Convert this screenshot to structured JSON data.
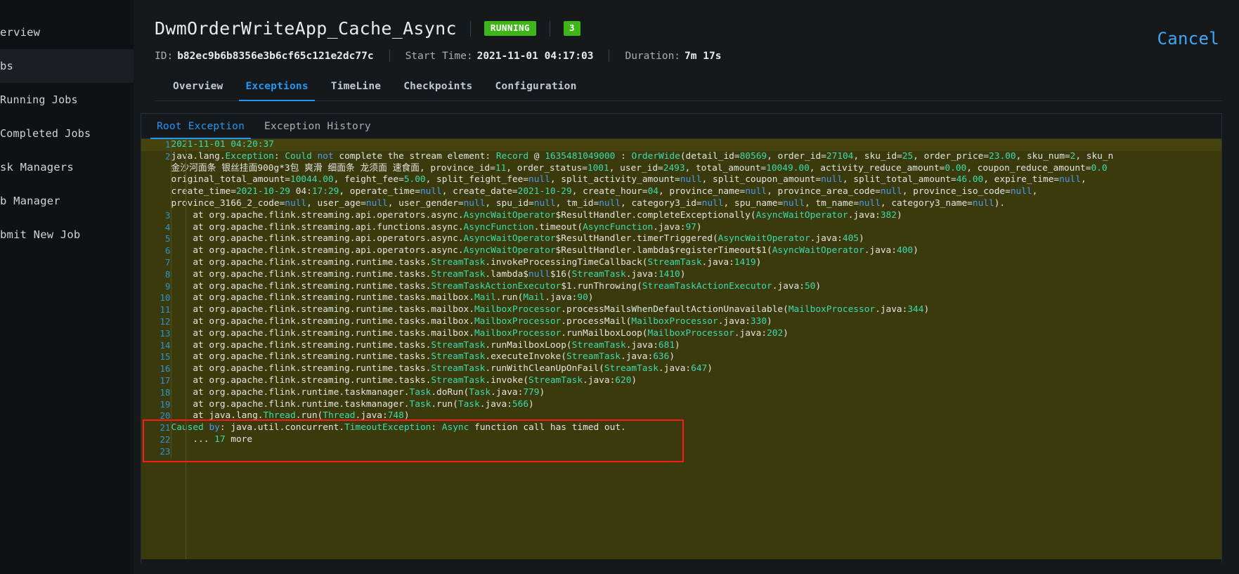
{
  "sidebar": {
    "items": [
      {
        "label": "erview"
      },
      {
        "label": "bs"
      },
      {
        "label": "Running Jobs"
      },
      {
        "label": "Completed Jobs"
      },
      {
        "label": "sk Managers"
      },
      {
        "label": "b Manager"
      },
      {
        "label": "bmit New Job"
      }
    ]
  },
  "header": {
    "job_name": "DwmOrderWriteApp_Cache_Async",
    "status_badge": "RUNNING",
    "parallelism_badge": "3",
    "id_label": "ID:",
    "id_value": "b82ec9b6b8356e3b6cf65c121e2dc77c",
    "start_time_label": "Start Time:",
    "start_time_value": "2021-11-01 04:17:03",
    "duration_label": "Duration:",
    "duration_value": "7m 17s",
    "cancel_label": "Cancel",
    "accent_color": "#2196f3",
    "status_color": "#3fb618"
  },
  "tabs": [
    {
      "label": "Overview",
      "active": false
    },
    {
      "label": "Exceptions",
      "active": true
    },
    {
      "label": "TimeLine",
      "active": false
    },
    {
      "label": "Checkpoints",
      "active": false
    },
    {
      "label": "Configuration",
      "active": false
    }
  ],
  "subtabs": [
    {
      "label": "Root Exception",
      "active": true
    },
    {
      "label": "Exception History",
      "active": false
    }
  ],
  "exception": {
    "highlight_border_color": "#ff1a1a",
    "code_background": "#3b3a0c",
    "lines": [
      {
        "n": "1",
        "text": "2021-11-01 04:20:37"
      },
      {
        "n": "2",
        "text": "java.lang.Exception: Could not complete the stream element: Record @ 1635481049000 : OrderWide(detail_id=80569, order_id=27104, sku_id=25, order_price=23.00, sku_num=2, sku_n"
      },
      {
        "n": "",
        "text": "金沙河面条 银丝挂面900g*3包 爽滑 细面条 龙须面 速食面, province_id=11, order_status=1001, user_id=2493, total_amount=10049.00, activity_reduce_amount=0.00, coupon_reduce_amount=0.0"
      },
      {
        "n": "",
        "text": "original_total_amount=10044.00, feight_fee=5.00, split_feight_fee=null, split_activity_amount=null, split_coupon_amount=null, split_total_amount=46.00, expire_time=null,"
      },
      {
        "n": "",
        "text": "create_time=2021-10-29 04:17:29, operate_time=null, create_date=2021-10-29, create_hour=04, province_name=null, province_area_code=null, province_iso_code=null,"
      },
      {
        "n": "",
        "text": "province_3166_2_code=null, user_age=null, user_gender=null, spu_id=null, tm_id=null, category3_id=null, spu_name=null, tm_name=null, category3_name=null)."
      },
      {
        "n": "3",
        "text": "    at org.apache.flink.streaming.api.operators.async.AsyncWaitOperator$ResultHandler.completeExceptionally(AsyncWaitOperator.java:382)"
      },
      {
        "n": "4",
        "text": "    at org.apache.flink.streaming.api.functions.async.AsyncFunction.timeout(AsyncFunction.java:97)"
      },
      {
        "n": "5",
        "text": "    at org.apache.flink.streaming.api.operators.async.AsyncWaitOperator$ResultHandler.timerTriggered(AsyncWaitOperator.java:405)"
      },
      {
        "n": "6",
        "text": "    at org.apache.flink.streaming.api.operators.async.AsyncWaitOperator$ResultHandler.lambda$registerTimeout$1(AsyncWaitOperator.java:400)"
      },
      {
        "n": "7",
        "text": "    at org.apache.flink.streaming.runtime.tasks.StreamTask.invokeProcessingTimeCallback(StreamTask.java:1419)"
      },
      {
        "n": "8",
        "text": "    at org.apache.flink.streaming.runtime.tasks.StreamTask.lambda$null$16(StreamTask.java:1410)"
      },
      {
        "n": "9",
        "text": "    at org.apache.flink.streaming.runtime.tasks.StreamTaskActionExecutor$1.runThrowing(StreamTaskActionExecutor.java:50)"
      },
      {
        "n": "10",
        "text": "    at org.apache.flink.streaming.runtime.tasks.mailbox.Mail.run(Mail.java:90)"
      },
      {
        "n": "11",
        "text": "    at org.apache.flink.streaming.runtime.tasks.mailbox.MailboxProcessor.processMailsWhenDefaultActionUnavailable(MailboxProcessor.java:344)"
      },
      {
        "n": "12",
        "text": "    at org.apache.flink.streaming.runtime.tasks.mailbox.MailboxProcessor.processMail(MailboxProcessor.java:330)"
      },
      {
        "n": "13",
        "text": "    at org.apache.flink.streaming.runtime.tasks.mailbox.MailboxProcessor.runMailboxLoop(MailboxProcessor.java:202)"
      },
      {
        "n": "14",
        "text": "    at org.apache.flink.streaming.runtime.tasks.StreamTask.runMailboxLoop(StreamTask.java:681)"
      },
      {
        "n": "15",
        "text": "    at org.apache.flink.streaming.runtime.tasks.StreamTask.executeInvoke(StreamTask.java:636)"
      },
      {
        "n": "16",
        "text": "    at org.apache.flink.streaming.runtime.tasks.StreamTask.runWithCleanUpOnFail(StreamTask.java:647)"
      },
      {
        "n": "17",
        "text": "    at org.apache.flink.streaming.runtime.tasks.StreamTask.invoke(StreamTask.java:620)"
      },
      {
        "n": "18",
        "text": "    at org.apache.flink.runtime.taskmanager.Task.doRun(Task.java:779)"
      },
      {
        "n": "19",
        "text": "    at org.apache.flink.runtime.taskmanager.Task.run(Task.java:566)"
      },
      {
        "n": "20",
        "text": "    at java.lang.Thread.run(Thread.java:748)"
      },
      {
        "n": "21",
        "text": "Caused by: java.util.concurrent.TimeoutException: Async function call has timed out."
      },
      {
        "n": "22",
        "text": "    ... 17 more"
      },
      {
        "n": "23",
        "text": ""
      }
    ]
  }
}
